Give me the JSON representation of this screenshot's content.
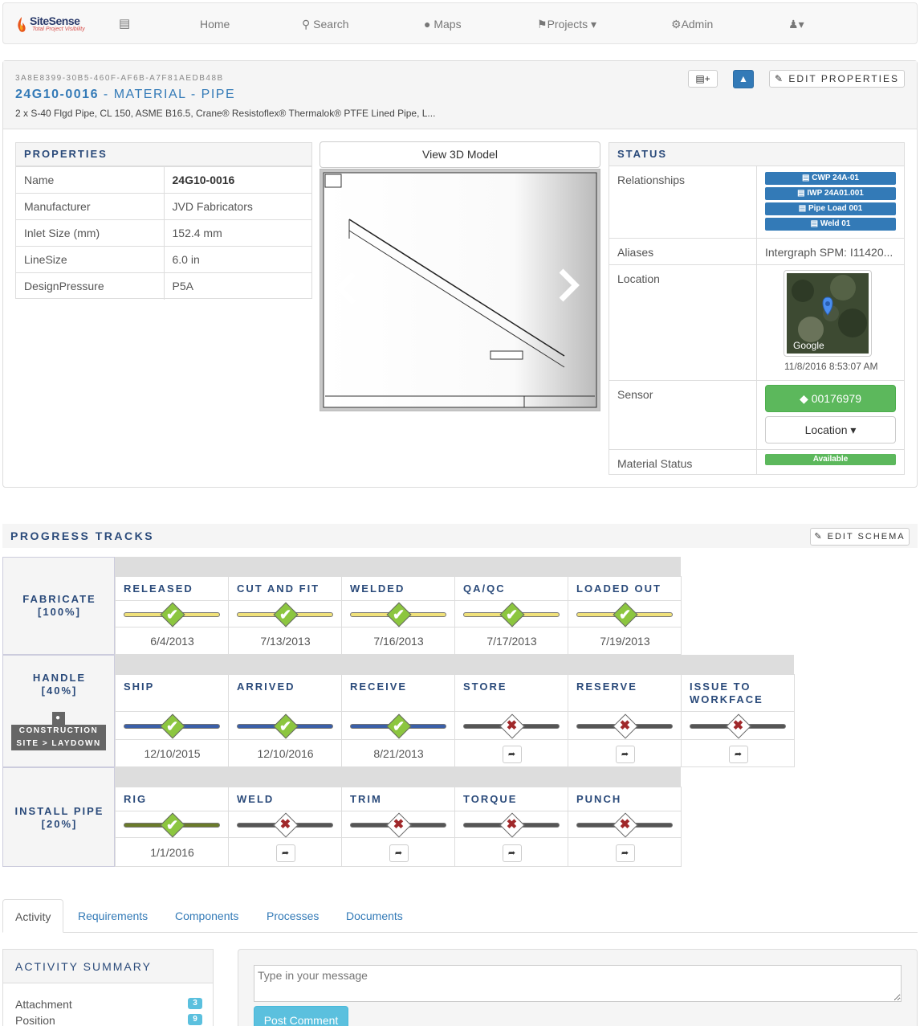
{
  "nav": {
    "brand": "SiteSense",
    "brand_tagline": "Total Project Visibility",
    "home": "Home",
    "search": "Search",
    "maps": "Maps",
    "projects": "Projects",
    "admin": "Admin"
  },
  "header": {
    "guid": "3A8E8399-30B5-460F-AF6B-A7F81AEDB48B",
    "tag": "24G10-0016",
    "type": "- MATERIAL - PIPE",
    "description": "2 x S-40 Flgd Pipe, CL 150, ASME B16.5, Crane® Resistoflex® Thermalok® PTFE Lined Pipe, L...",
    "edit_properties": "EDIT PROPERTIES"
  },
  "properties": {
    "heading": "PROPERTIES",
    "rows": [
      {
        "name": "Name",
        "value": "24G10-0016"
      },
      {
        "name": "Manufacturer",
        "value": "JVD Fabricators"
      },
      {
        "name": "Inlet Size (mm)",
        "value": "152.4 mm"
      },
      {
        "name": "LineSize",
        "value": "6.0 in"
      },
      {
        "name": "DesignPressure",
        "value": "P5A"
      }
    ]
  },
  "viewer": {
    "button": "View 3D Model"
  },
  "status": {
    "heading": "STATUS",
    "relationships_label": "Relationships",
    "relationships": [
      "CWP 24A-01",
      "IWP 24A01.001",
      "Pipe Load 001",
      "Weld 01"
    ],
    "aliases_label": "Aliases",
    "aliases": "Intergraph SPM: I11420...",
    "location_label": "Location",
    "map_brand": "Google",
    "location_time": "11/8/2016 8:53:07 AM",
    "sensor_label": "Sensor",
    "sensor_id": "00176979",
    "sensor_location": "Location",
    "material_status_label": "Material Status",
    "material_status": "Available"
  },
  "progress": {
    "heading": "PROGRESS TRACKS",
    "edit_schema": "EDIT SCHEMA",
    "tracks": [
      {
        "name": "FABRICATE",
        "pct": "[100%]",
        "steps": [
          {
            "name": "RELEASED",
            "done": true,
            "date": "6/4/2013"
          },
          {
            "name": "CUT AND FIT",
            "done": true,
            "date": "7/13/2013"
          },
          {
            "name": "WELDED",
            "done": true,
            "date": "7/16/2013"
          },
          {
            "name": "QA/QC",
            "done": true,
            "date": "7/17/2013"
          },
          {
            "name": "LOADED OUT",
            "done": true,
            "date": "7/19/2013"
          }
        ]
      },
      {
        "name": "HANDLE",
        "pct": "[40%]",
        "location_line1": "CONSTRUCTION",
        "location_line2": "SITE > LAYDOWN",
        "steps": [
          {
            "name": "SHIP",
            "done": true,
            "date": "12/10/2015"
          },
          {
            "name": "ARRIVED",
            "done": true,
            "date": "12/10/2016"
          },
          {
            "name": "RECEIVE",
            "done": true,
            "date": "8/21/2013"
          },
          {
            "name": "STORE",
            "done": false,
            "date": ""
          },
          {
            "name": "RESERVE",
            "done": false,
            "date": ""
          },
          {
            "name": "ISSUE TO WORKFACE",
            "done": false,
            "date": ""
          }
        ]
      },
      {
        "name": "INSTALL PIPE",
        "pct": "[20%]",
        "steps": [
          {
            "name": "RIG",
            "done": true,
            "date": "1/1/2016"
          },
          {
            "name": "WELD",
            "done": false,
            "date": ""
          },
          {
            "name": "TRIM",
            "done": false,
            "date": ""
          },
          {
            "name": "TORQUE",
            "done": false,
            "date": ""
          },
          {
            "name": "PUNCH",
            "done": false,
            "date": ""
          }
        ]
      }
    ],
    "colors": {
      "fabricate": "#f0e17a",
      "handle": "#3a5fa8",
      "install": "#6a7a2a",
      "pending": "#555555"
    }
  },
  "tabs": [
    "Activity",
    "Requirements",
    "Components",
    "Processes",
    "Documents"
  ],
  "activity": {
    "heading": "ACTIVITY SUMMARY",
    "items": [
      {
        "label": "Attachment",
        "count": "3"
      },
      {
        "label": "Position",
        "count": "9"
      }
    ],
    "message_placeholder": "Type in your message",
    "post_button": "Post Comment"
  }
}
